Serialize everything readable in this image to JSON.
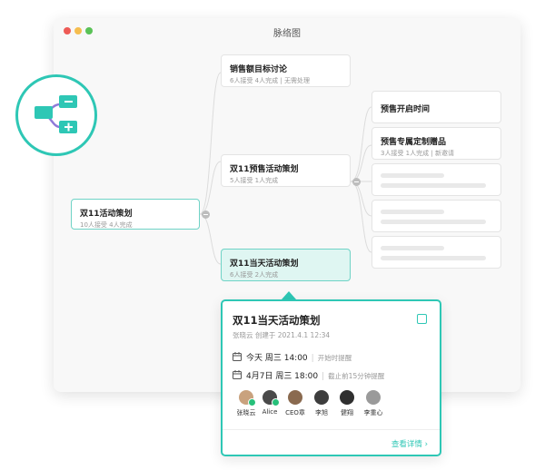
{
  "window": {
    "title": "脉络图"
  },
  "nodes": {
    "root": {
      "title": "双11活动策划",
      "meta": "10人接受 4人完成"
    },
    "branch1": {
      "title": "销售额目标讨论",
      "meta": "6人接受 4人完成 | 无需处理"
    },
    "branch2": {
      "title": "双11预售活动策划",
      "meta": "5人接受 1人完成"
    },
    "branch3": {
      "title": "双11当天活动策划",
      "meta": "6人接受 2人完成"
    },
    "leaf1": {
      "title": "预售开启时间"
    },
    "leaf2": {
      "title": "预售专属定制赠品",
      "meta": "3人接受 1人完成 | 新邀请"
    }
  },
  "popup": {
    "title": "双11当天活动策划",
    "meta": "张晓云 创建于 2021.4.1 12:34",
    "row1": {
      "time": "今天 周三 14:00",
      "reminder": "开始时提醒"
    },
    "row2": {
      "time": "4月7日 周三 18:00",
      "reminder": "截止前15分钟提醒"
    },
    "members": [
      {
        "name": "张晓云",
        "done": true,
        "color": "#c9a27e"
      },
      {
        "name": "Alice",
        "done": true,
        "color": "#4a4a4a"
      },
      {
        "name": "CEO章",
        "done": false,
        "color": "#8a6a4f"
      },
      {
        "name": "李旭",
        "done": false,
        "color": "#3d3d3d"
      },
      {
        "name": "健翔",
        "done": false,
        "color": "#2f2f2f"
      },
      {
        "name": "李重心",
        "done": false,
        "color": "#9a9a9a"
      }
    ],
    "more": "查看详情 ›"
  },
  "colors": {
    "accent": "#2ec7b5",
    "selected_bg": "#dff6f2"
  },
  "icons": {
    "badge": "mindmap-add-icon"
  }
}
